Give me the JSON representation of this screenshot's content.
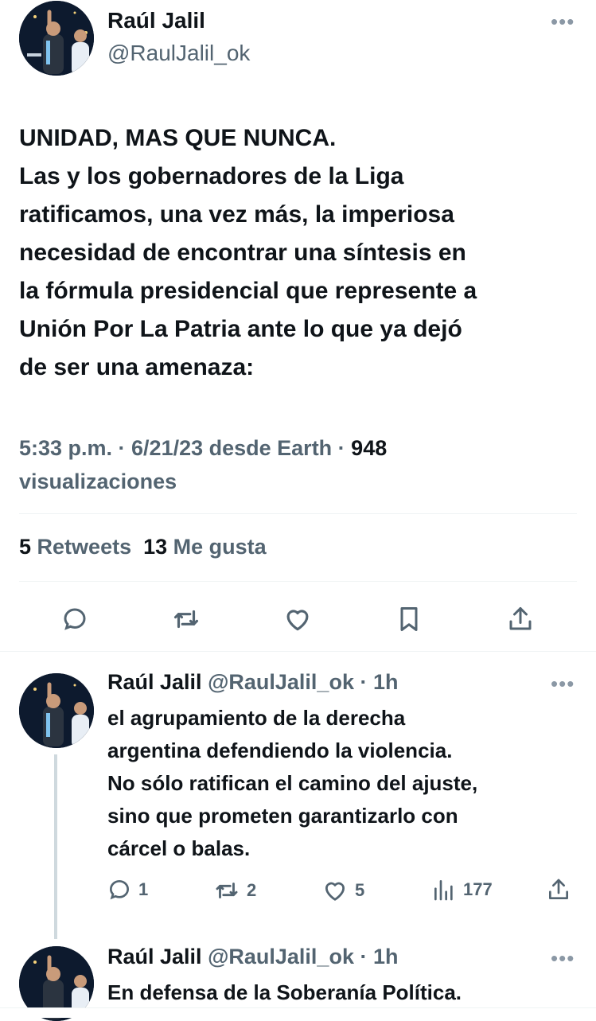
{
  "main_tweet": {
    "author_name": "Raúl Jalil",
    "handle": "@RaulJalil_ok",
    "text": "UNIDAD, MAS QUE NUNCA.\nLas y los gobernadores de la Liga\nratificamos, una vez más, la imperiosa\nnecesidad de encontrar una síntesis en\nla fórmula presidencial que represente a\nUnión Por La Patria ante lo que ya dejó\nde ser una amenaza:",
    "meta_time_source": "5:33 p.m. · 6/21/23 desde Earth · ",
    "views_count": "948",
    "views_label": "visualizaciones",
    "retweets_count": "5",
    "retweets_label": "Retweets",
    "likes_count": "13",
    "likes_label": "Me gusta"
  },
  "replies": [
    {
      "author_name": "Raúl Jalil",
      "handle_time": "@RaulJalil_ok · 1h",
      "text": "el agrupamiento de la derecha\nargentina defendiendo la violencia.\nNo sólo ratifican el camino del ajuste,\nsino que prometen garantizarlo con\ncárcel o balas.",
      "reply_count": "1",
      "retweet_count": "2",
      "like_count": "5",
      "view_count": "177"
    },
    {
      "author_name": "Raúl Jalil",
      "handle_time": "@RaulJalil_ok · 1h",
      "text": "En defensa de la Soberanía Política."
    }
  ],
  "icons": {
    "more": "more-dots-icon",
    "reply": "reply-icon",
    "retweet": "retweet-icon",
    "like": "like-icon",
    "bookmark": "bookmark-icon",
    "share": "share-icon",
    "views": "views-icon"
  },
  "colors": {
    "text": "#0f1419",
    "secondary": "#536471",
    "divider": "#eff3f4"
  }
}
